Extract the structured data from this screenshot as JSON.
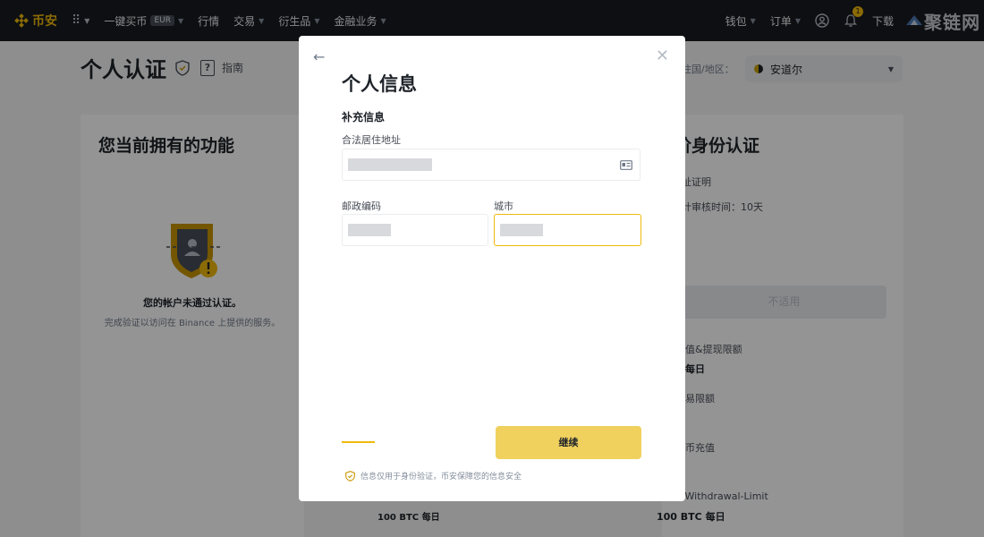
{
  "nav": {
    "brand": "币安",
    "items": [
      {
        "label": "一键买币",
        "badge": "EUR"
      },
      {
        "label": "行情"
      },
      {
        "label": "交易"
      },
      {
        "label": "衍生品"
      },
      {
        "label": "金融业务"
      }
    ],
    "wallet": "钱包",
    "orders": "订单",
    "notification_count": "1",
    "download": "下载",
    "watermark": "聚链网"
  },
  "background": {
    "page_title": "个人认证",
    "guide_label": "指南",
    "country_label": "住国/地区：",
    "country_value": "安道尔",
    "left_card": {
      "title": "您当前拥有的功能",
      "status": "您的帐户未通过认证。",
      "hint": "完成验证以访问在 Binance 上提供的服务。",
      "limit": "100 BTC 每日"
    },
    "right_card": {
      "title": "阶身份认证",
      "line1": "址证明",
      "line2": "计审核时间：10天",
      "na_button": "不适用",
      "line3": "值&提现限额",
      "line4": "每日",
      "line5": "易限额",
      "line6": "币充值",
      "line7": "-Withdrawal-Limit",
      "limit": "100 BTC 每日"
    }
  },
  "modal": {
    "title": "个人信息",
    "section": "补充信息",
    "address_label": "合法居住地址",
    "postal_label": "邮政编码",
    "city_label": "城市",
    "continue_label": "继续",
    "privacy_text": "信息仅用于身份验证，币安保障您的信息安全"
  },
  "colors": {
    "brand": "#f0b90b",
    "nav_bg": "#181a20",
    "button": "#f0d15e"
  }
}
